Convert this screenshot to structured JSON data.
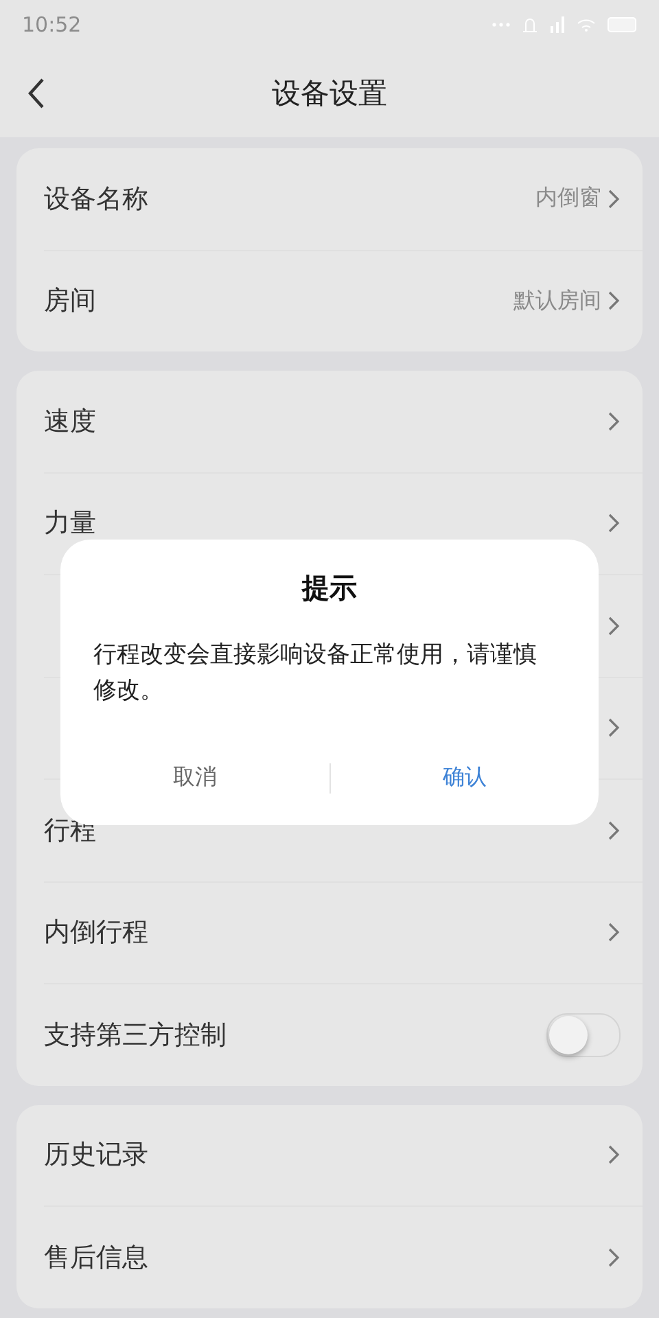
{
  "status_bar": {
    "time": "10:52"
  },
  "header": {
    "title": "设备设置"
  },
  "groups": [
    {
      "rows": [
        {
          "kind": "link",
          "label": "设备名称",
          "value": "内倒窗"
        },
        {
          "kind": "link",
          "label": "房间",
          "value": "默认房间"
        }
      ]
    },
    {
      "rows": [
        {
          "kind": "link",
          "label": "速度"
        },
        {
          "kind": "link",
          "label": "力量"
        },
        {
          "kind": "link"
        },
        {
          "kind": "link"
        },
        {
          "kind": "link",
          "label": "行程"
        },
        {
          "kind": "link",
          "label": "内倒行程"
        },
        {
          "kind": "toggle",
          "label": "支持第三方控制",
          "on": false
        }
      ]
    },
    {
      "rows": [
        {
          "kind": "link",
          "label": "历史记录"
        },
        {
          "kind": "link",
          "label": "售后信息"
        }
      ]
    }
  ],
  "dialog": {
    "title": "提示",
    "message": "行程改变会直接影响设备正常使用，请谨慎修改。",
    "buttons": [
      {
        "label": "取消",
        "kind": "cancel"
      },
      {
        "label": "确认",
        "kind": "confirm"
      }
    ]
  }
}
